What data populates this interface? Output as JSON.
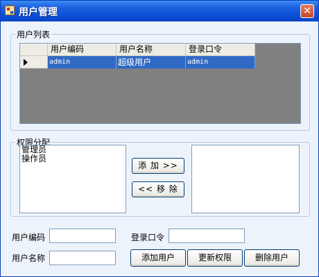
{
  "window": {
    "title": "用户管理",
    "close_glyph": "✕"
  },
  "user_list": {
    "legend": "用户列表",
    "columns": [
      "用户编码",
      "用户名称",
      "登录口令"
    ],
    "rows": [
      {
        "code": "admin",
        "name": "超级用户",
        "password": "admin"
      }
    ]
  },
  "permissions": {
    "legend": "权限分配",
    "available": [
      "管理员",
      "操作员"
    ],
    "assigned": [],
    "add_button": "添 加 >>",
    "remove_button": "<< 移 除"
  },
  "form": {
    "code_label": "用户编码",
    "name_label": "用户名称",
    "password_label": "登录口令",
    "code_value": "",
    "name_value": "",
    "password_value": ""
  },
  "actions": {
    "add_user": "添加用户",
    "update_permissions": "更新权限",
    "delete_user": "删除用户"
  },
  "icons": {
    "window": "app-window-icon",
    "row_selector": "row-pointer-icon"
  }
}
